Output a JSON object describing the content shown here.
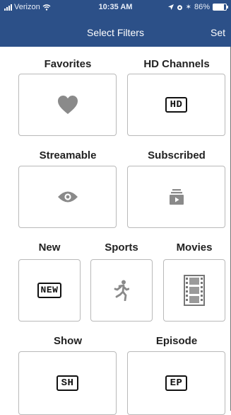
{
  "status": {
    "carrier": "Verizon",
    "time": "10:35 AM",
    "battery": "86%"
  },
  "nav": {
    "title": "Select Filters",
    "set_label": "Set"
  },
  "filters": {
    "favorites": {
      "label": "Favorites"
    },
    "hd": {
      "label": "HD Channels",
      "badge": "HD"
    },
    "streamable": {
      "label": "Streamable"
    },
    "subscribed": {
      "label": "Subscribed"
    },
    "new": {
      "label": "New",
      "badge": "NEW"
    },
    "sports": {
      "label": "Sports"
    },
    "movies": {
      "label": "Movies"
    },
    "show": {
      "label": "Show",
      "badge": "SH"
    },
    "episode": {
      "label": "Episode",
      "badge": "EP"
    }
  },
  "icons": {
    "favorites": "heart-icon",
    "streamable": "eye-icon",
    "subscribed": "stack-icon",
    "sports": "runner-icon",
    "movies": "film-strip-icon"
  },
  "colors": {
    "nav_bg": "#2c5088",
    "icon_gray": "#8a8a8a",
    "tile_border": "#b9b9b9"
  }
}
